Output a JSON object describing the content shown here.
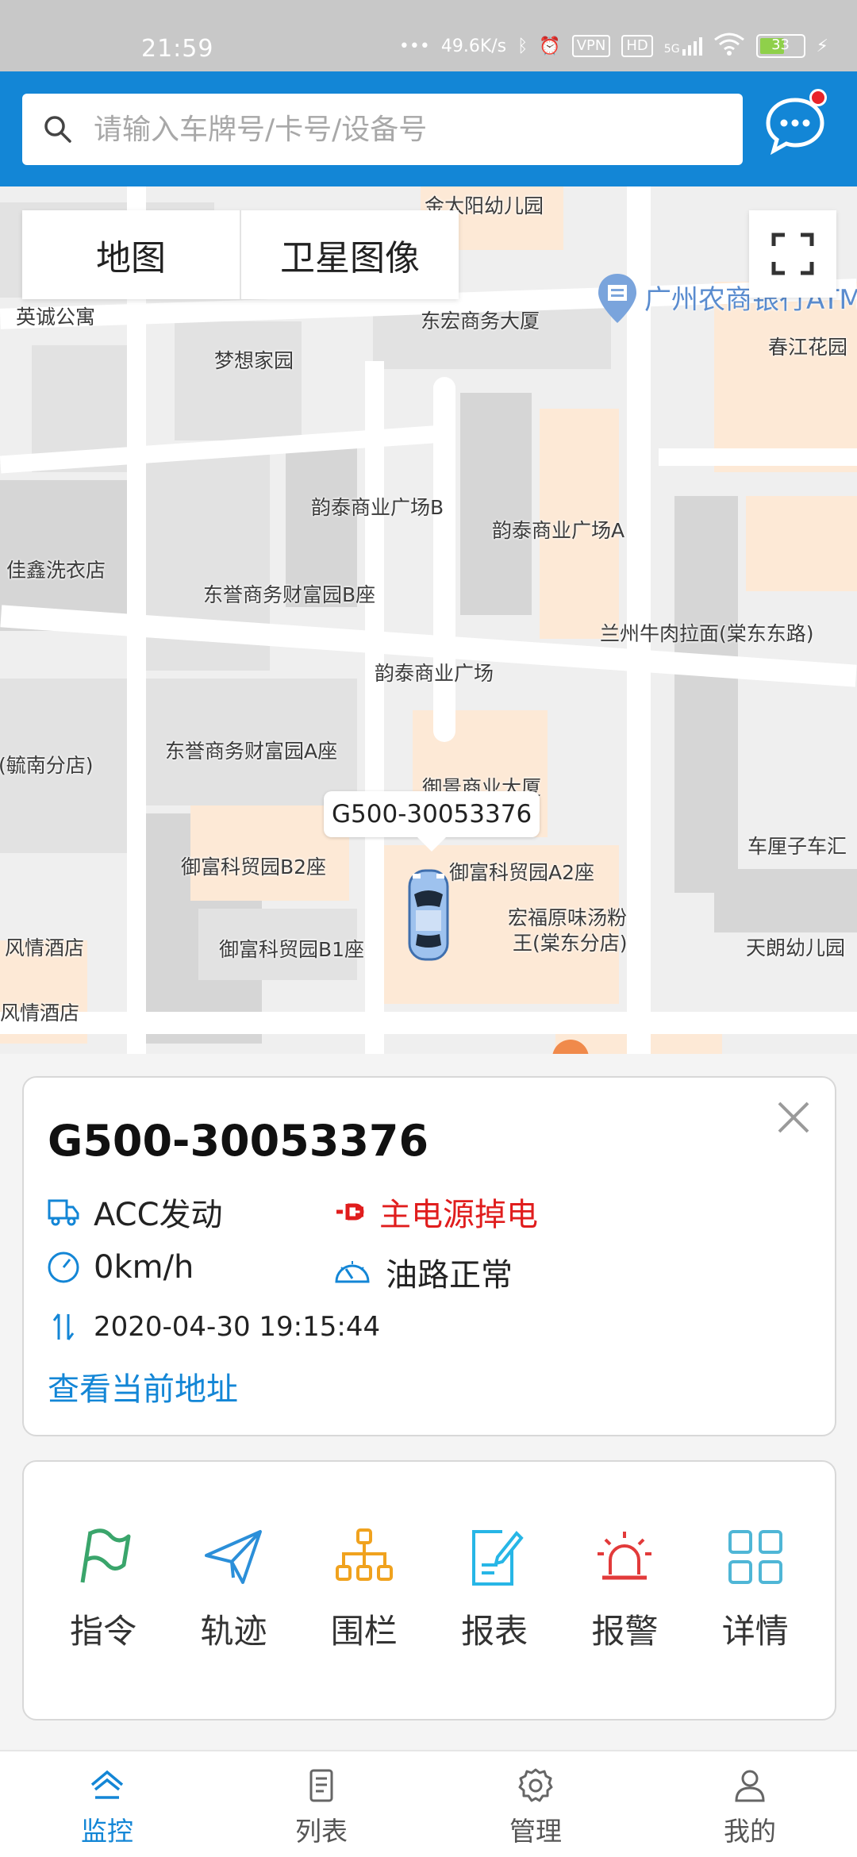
{
  "status_bar": {
    "time": "21:59",
    "network_speed": "49.6K/s",
    "vpn_label": "VPN",
    "hd_label": "HD",
    "signal_label": "5G",
    "battery_level": "33"
  },
  "search": {
    "placeholder": "请输入车牌号/卡号/设备号"
  },
  "map": {
    "tabs": [
      "地图",
      "卫星图像"
    ],
    "places": [
      "金太阳幼儿园",
      "英诚公寓",
      "东宏商务大厦",
      "广州农商银行ATM",
      "春江花园",
      "梦想家园",
      "韵泰商业广场B",
      "韵泰商业广场A",
      "佳鑫洗衣店",
      "东誉商务财富园B座",
      "兰州牛肉拉面(棠东东路)",
      "韵泰商业广场",
      "东誉商务财富园A座",
      "(毓南分店)",
      "御景商业大厦",
      "车厘子车汇",
      "御富科贸园B2座",
      "御富科贸园A2座",
      "宏福原味汤粉",
      "王(棠东分店)",
      "风情酒店",
      "御富科贸园B1座",
      "天朗幼儿园",
      "风情酒店"
    ],
    "vehicle_label": "G500-30053376"
  },
  "vehicle": {
    "plate": "G500-30053376",
    "acc_status": "ACC发动",
    "power_status": "主电源掉电",
    "speed": "0km/h",
    "oil_status": "油路正常",
    "timestamp": "2020-04-30 19:15:44",
    "address_link": "查看当前地址",
    "colors": {
      "accent": "#1386d6",
      "alert": "#e01d1d"
    }
  },
  "actions": [
    {
      "label": "指令",
      "icon": "flag-icon",
      "color": "#3aa56b"
    },
    {
      "label": "轨迹",
      "icon": "paper-plane-icon",
      "color": "#2b8fd9"
    },
    {
      "label": "围栏",
      "icon": "network-icon",
      "color": "#f0a21e"
    },
    {
      "label": "报表",
      "icon": "report-icon",
      "color": "#27b6e6"
    },
    {
      "label": "报警",
      "icon": "alarm-icon",
      "color": "#e23a3a"
    },
    {
      "label": "详情",
      "icon": "grid-icon",
      "color": "#4fb6d6"
    }
  ],
  "bottom_nav": [
    {
      "label": "监控",
      "icon": "monitor-home-icon",
      "active": true
    },
    {
      "label": "列表",
      "icon": "list-doc-icon",
      "active": false
    },
    {
      "label": "管理",
      "icon": "gear-icon",
      "active": false
    },
    {
      "label": "我的",
      "icon": "user-icon",
      "active": false
    }
  ]
}
